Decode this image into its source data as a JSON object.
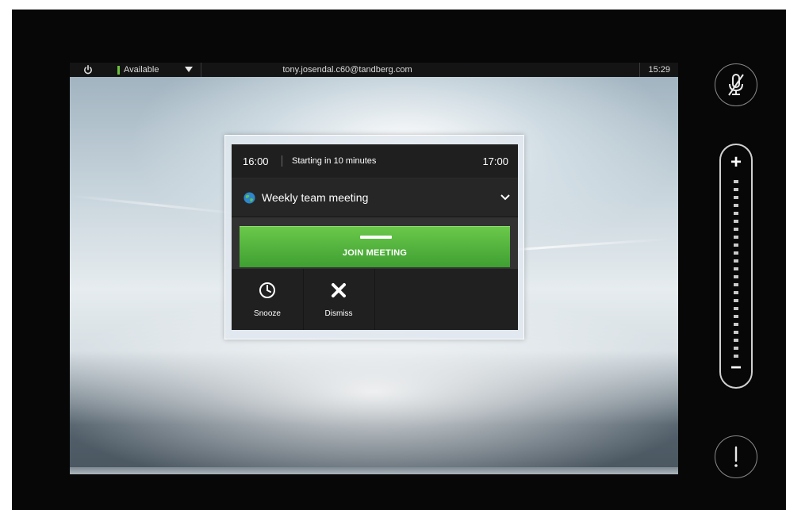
{
  "status_bar": {
    "power_icon": "power-icon",
    "availability": "Available",
    "availability_color": "#6cc23a",
    "user_uri": "tony.josendal.c60@tandberg.com",
    "clock": "15:29"
  },
  "meeting_dialog": {
    "start_time": "16:00",
    "status_text": "Starting in 10 minutes",
    "end_time": "17:00",
    "title": "Weekly team meeting",
    "join_label": "JOIN MEETING",
    "join_color": "#4caf3a",
    "actions": [
      {
        "label": "Snooze",
        "icon": "clock-icon"
      },
      {
        "label": "Dismiss",
        "icon": "close-icon"
      }
    ]
  },
  "side_controls": {
    "mic_icon": "microphone-muted-icon",
    "volume_plus": "+",
    "volume_minus": "−",
    "alert_icon": "exclamation-icon"
  }
}
